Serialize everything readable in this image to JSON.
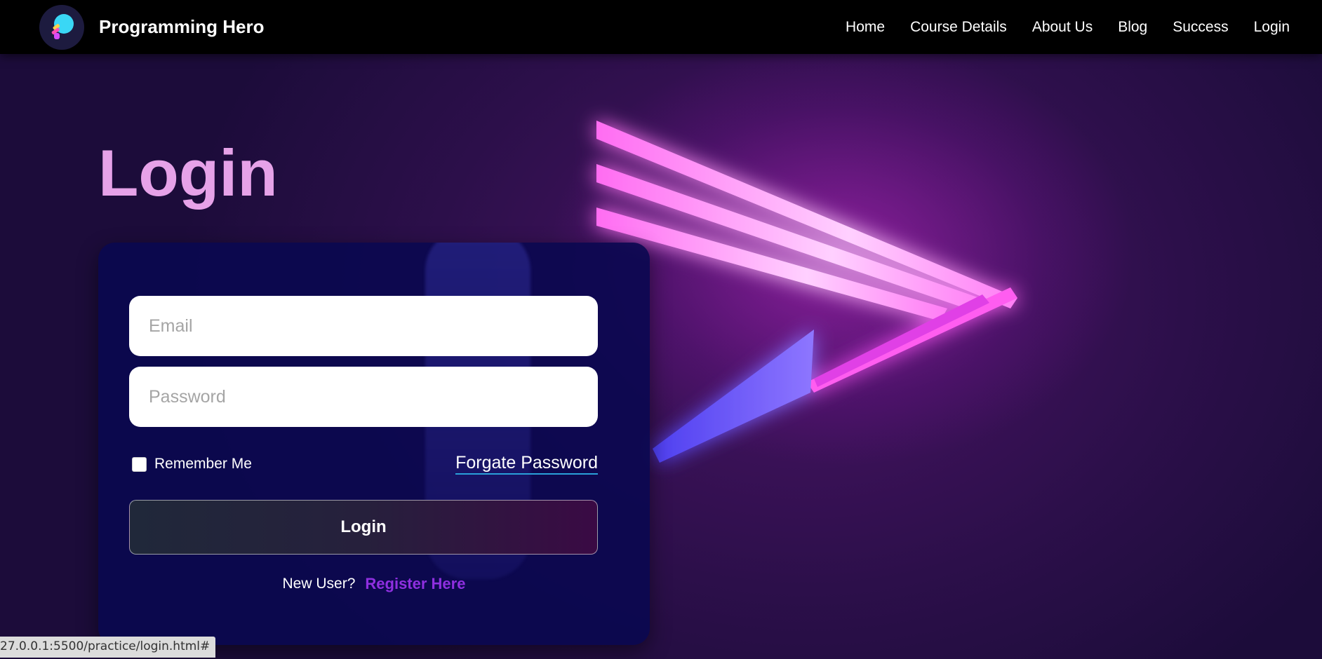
{
  "navbar": {
    "brand": "Programming Hero",
    "logo_icon": "programming-hero-logo-icon",
    "links": [
      "Home",
      "Course Details",
      "About Us",
      "Blog",
      "Success",
      "Login"
    ]
  },
  "page": {
    "title": "Login"
  },
  "form": {
    "email_placeholder": "Email",
    "password_placeholder": "Password",
    "remember_label": "Remember Me",
    "forgot_link": "Forgate Password",
    "submit_label": "Login",
    "new_user_text": "New User?",
    "register_link": "Register Here"
  },
  "status_bar": {
    "url": "27.0.0.1:5500/practice/login.html#"
  },
  "colors": {
    "accent_title": "#e6a2e8",
    "register_link": "#8f2fe0",
    "navbar_bg": "#000000",
    "card_bg": "#0a0850"
  }
}
